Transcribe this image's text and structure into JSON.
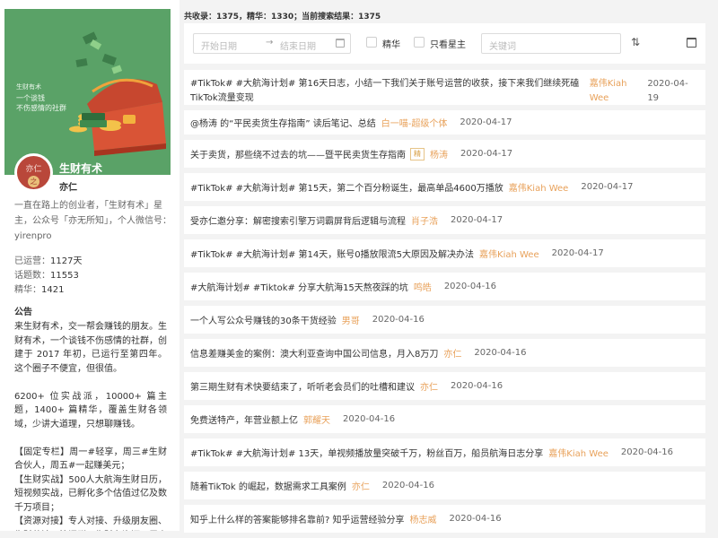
{
  "sidebar": {
    "cover": {
      "brand": "生财有术",
      "slogan_line1": "一个谈钱",
      "slogan_line2": "不伤感情的社群"
    },
    "avatar": {
      "text": "亦仁",
      "stamp": "之"
    },
    "group_name": "生财有术",
    "owner": "亦仁",
    "intro": "一直在路上的创业者，「生财有术」星主，公众号「亦无所知」，个人微信号：yirenpro",
    "stats": [
      {
        "label": "已运营：",
        "value": "1127天"
      },
      {
        "label": "话题数：",
        "value": "11553"
      },
      {
        "label": "精华：",
        "value": "1421"
      }
    ],
    "notice_title": "公告",
    "notice": "来生财有术，交一帮会赚钱的朋友。生财有术，一个谈钱不伤感情的社群，创建于 2017 年初，已运行至第四年。这个圈子不便宜，但很值。\n\n6200+ 位实战派，10000+ 篇主题，1400+ 篇精华，覆盖生财各领域，少讲大道理，只想聊赚钱。\n\n【固定专栏】周一#轻享，周三#生财合伙人，周五#一起赚美元；\n【生财实战】500人大航海生财日历，短视频实战，已孵化多个估值过亿及数千万项目；\n【资源对接】专人对接、升级朋友圈、生财茶馆、快闪群、生财有资源，周点资源免费对接；"
  },
  "summary": "共收录：1375，精华：1330；当前搜索结果：1375",
  "filter": {
    "start_placeholder": "开始日期",
    "arrow": "→",
    "end_placeholder": "结束日期",
    "essence_label": "精华",
    "star_only_label": "只看星主",
    "keyword_placeholder": "关键词",
    "sort_icon": "⇅"
  },
  "topics": [
    {
      "title": "#TikTok# #大航海计划# 第16天日志，小结一下我们关于账号运营的收获，接下来我们继续死磕TikTok流量变现",
      "author": "嘉伟Kiah Wee",
      "date": "2020-04-19"
    },
    {
      "title": "@杨涛 的“平民卖货生存指南” 读后笔记、总结",
      "author": "白一喵-超级个体",
      "date": "2020-04-17"
    },
    {
      "title": "关于卖货，那些绕不过去的坑——暨平民卖货生存指南",
      "badge": "精",
      "author": "杨涛",
      "date": "2020-04-17"
    },
    {
      "title": "#TikTok# #大航海计划# 第15天，第二个百分粉诞生，最高单品4600万播放",
      "author": "嘉伟Kiah Wee",
      "date": "2020-04-17"
    },
    {
      "title": "受亦仁邀分享：解密搜索引擎万词霸屏背后逻辑与流程",
      "author": "肖子浩",
      "date": "2020-04-17"
    },
    {
      "title": "#TikTok# #大航海计划# 第14天，账号0播放限流5大原因及解决办法",
      "author": "嘉伟Kiah Wee",
      "date": "2020-04-17"
    },
    {
      "title": "#大航海计划# #Tiktok# 分享大航海15天熬夜踩的坑",
      "author": "鸣皓",
      "date": "2020-04-16"
    },
    {
      "title": "一个人写公众号赚钱的30条干货经验",
      "author": "男哥",
      "date": "2020-04-16"
    },
    {
      "title": "信息差赚美金的案例：澳大利亚查询中国公司信息，月入8万刀",
      "author": "亦仁",
      "date": "2020-04-16"
    },
    {
      "title": "第三期生财有术快要结束了，听听老会员们的吐槽和建议",
      "author": "亦仁",
      "date": "2020-04-16"
    },
    {
      "title": "免费送特产，年营业额上亿",
      "author": "郭耀天",
      "date": "2020-04-16"
    },
    {
      "title": "#TikTok# #大航海计划# 13天，单视频播放量突破千万，粉丝百万，船员航海日志分享",
      "author": "嘉伟Kiah Wee",
      "date": "2020-04-16"
    },
    {
      "title": "随着TikTok 的崛起，数据需求工具案例",
      "author": "亦仁",
      "date": "2020-04-16"
    },
    {
      "title": "知乎上什么样的答案能够排名靠前? 知乎运营经验分享",
      "author": "杨志威",
      "date": "2020-04-16"
    }
  ],
  "colors": {
    "cover_green": "#5aa267",
    "author_orange": "#e8a15a",
    "page_bg": "#f3f3f3"
  }
}
